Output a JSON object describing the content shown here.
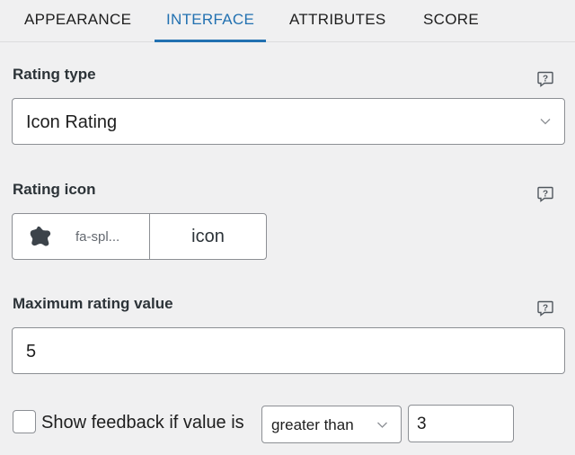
{
  "tabs": [
    {
      "label": "APPEARANCE",
      "active": false
    },
    {
      "label": "INTERFACE",
      "active": true
    },
    {
      "label": "ATTRIBUTES",
      "active": false
    },
    {
      "label": "SCORE",
      "active": false
    }
  ],
  "rating_type": {
    "label": "Rating type",
    "value": "Icon Rating"
  },
  "rating_icon": {
    "label": "Rating icon",
    "icon_name": "fa-spl...",
    "button_label": "icon"
  },
  "max_rating": {
    "label": "Maximum rating value",
    "value": "5"
  },
  "feedback": {
    "checked": false,
    "label": "Show feedback if value is",
    "comparison": "greater than",
    "threshold": "3"
  },
  "colors": {
    "accent": "#2271b1",
    "background": "#f0f0f1",
    "border": "#8c8f94"
  }
}
